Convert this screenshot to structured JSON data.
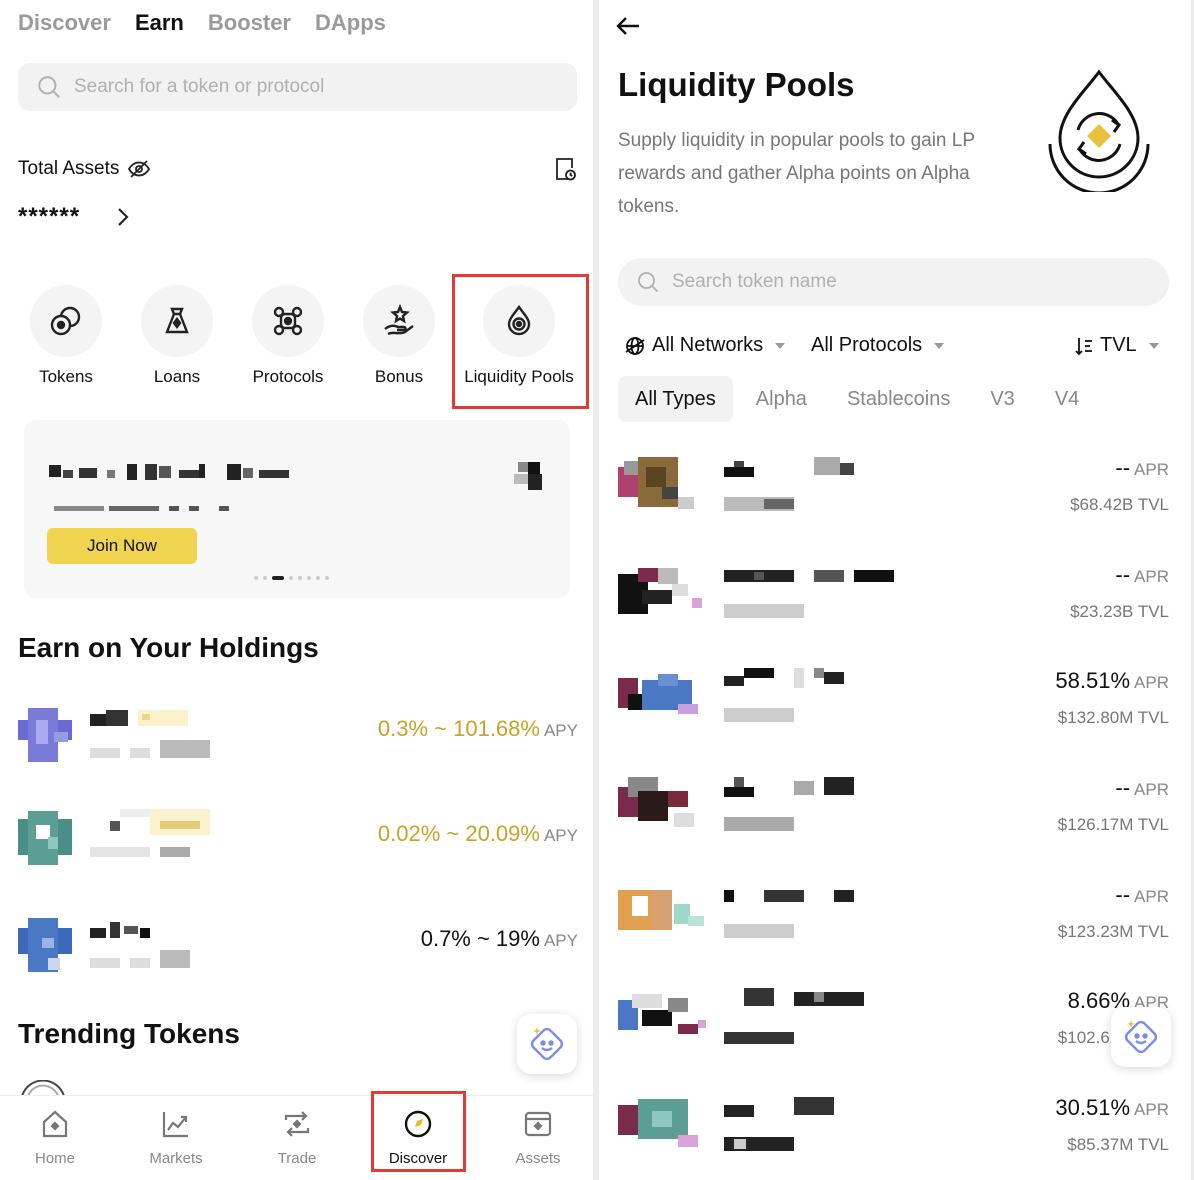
{
  "left": {
    "tabs": [
      {
        "label": "Discover",
        "active": false
      },
      {
        "label": "Earn",
        "active": true
      },
      {
        "label": "Booster",
        "active": false
      },
      {
        "label": "DApps",
        "active": false
      }
    ],
    "search_placeholder": "Search for a token or protocol",
    "total_assets_label": "Total Assets",
    "masked_balance": "******",
    "quick_actions": [
      {
        "label": "Tokens",
        "icon": "tokens-icon"
      },
      {
        "label": "Loans",
        "icon": "loans-icon"
      },
      {
        "label": "Protocols",
        "icon": "protocols-icon"
      },
      {
        "label": "Bonus",
        "icon": "bonus-icon"
      },
      {
        "label": "Liquidity Pools",
        "icon": "liquidity-pools-icon"
      }
    ],
    "banner": {
      "button": "Join Now"
    },
    "earn_title": "Earn on Your Holdings",
    "holdings": [
      {
        "rate": "0.3% ~ 101.68%",
        "unit": "APY",
        "highlight": true
      },
      {
        "rate": "0.02% ~ 20.09%",
        "unit": "APY",
        "highlight": true
      },
      {
        "rate": "0.7% ~ 19%",
        "unit": "APY",
        "highlight": false
      }
    ],
    "trending_title": "Trending Tokens",
    "nav": [
      {
        "label": "Home",
        "icon": "home-icon",
        "active": false
      },
      {
        "label": "Markets",
        "icon": "markets-icon",
        "active": false
      },
      {
        "label": "Trade",
        "icon": "trade-icon",
        "active": false
      },
      {
        "label": "Discover",
        "icon": "discover-icon",
        "active": true
      },
      {
        "label": "Assets",
        "icon": "assets-icon",
        "active": false
      }
    ]
  },
  "right": {
    "title": "Liquidity Pools",
    "description": "Supply liquidity in popular pools to gain LP rewards and gather Alpha points on Alpha tokens.",
    "search_placeholder": "Search token name",
    "filters": {
      "networks": "All Networks",
      "protocols": "All Protocols",
      "sort": "TVL"
    },
    "types": [
      {
        "label": "All Types",
        "active": true
      },
      {
        "label": "Alpha",
        "active": false
      },
      {
        "label": "Stablecoins",
        "active": false
      },
      {
        "label": "V3",
        "active": false
      },
      {
        "label": "V4",
        "active": false
      }
    ],
    "pools": [
      {
        "apr": "--",
        "apr_unit": "APR",
        "tvl": "$68.42B TVL"
      },
      {
        "apr": "--",
        "apr_unit": "APR",
        "tvl": "$23.23B TVL"
      },
      {
        "apr": "58.51%",
        "apr_unit": "APR",
        "tvl": "$132.80M TVL"
      },
      {
        "apr": "--",
        "apr_unit": "APR",
        "tvl": "$126.17M TVL"
      },
      {
        "apr": "--",
        "apr_unit": "APR",
        "tvl": "$123.23M TVL"
      },
      {
        "apr": "8.66%",
        "apr_unit": "APR",
        "tvl": "$102.62M TVL"
      },
      {
        "apr": "30.51%",
        "apr_unit": "APR",
        "tvl": "$85.37M TVL"
      }
    ]
  },
  "colors": {
    "accent_gold": "#c9a227",
    "highlight_red": "#e53935",
    "join_yellow": "#f0d34f"
  }
}
